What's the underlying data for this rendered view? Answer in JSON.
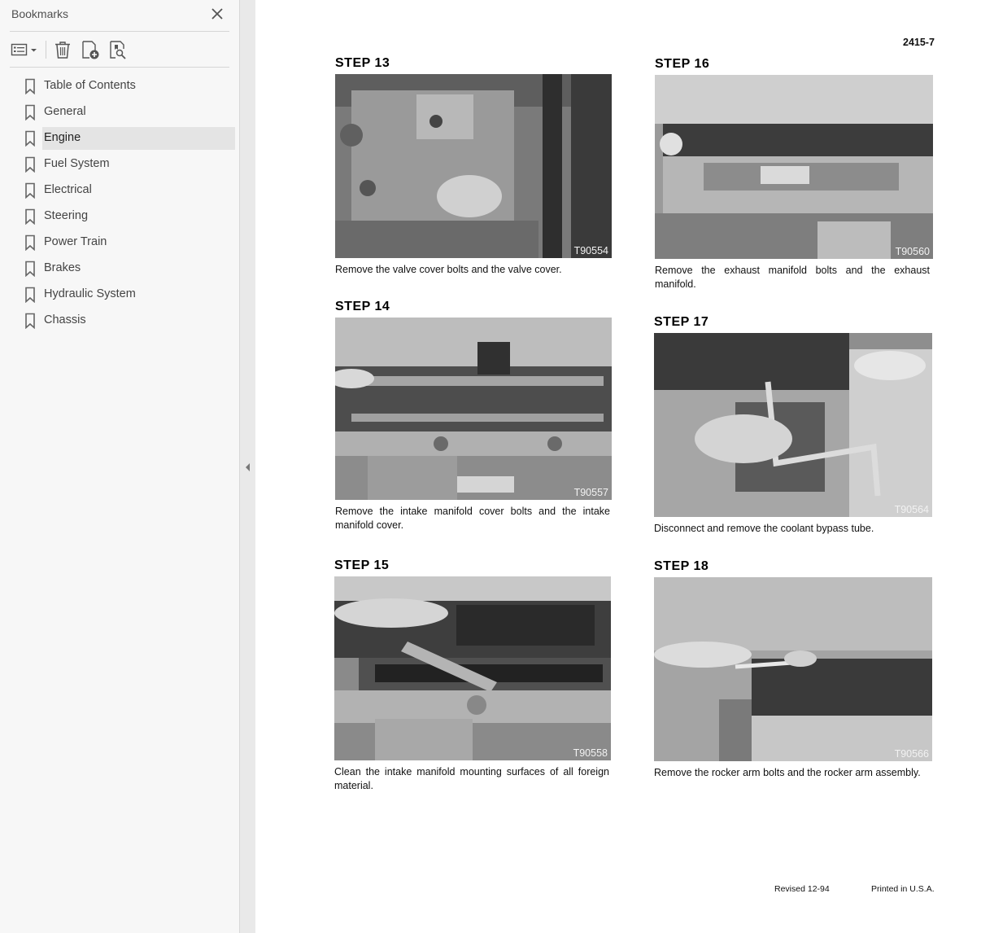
{
  "sidebar": {
    "title": "Bookmarks",
    "close_icon": "close-icon",
    "toolbar": {
      "options": "bookmark-options-icon",
      "delete": "trash-icon",
      "add": "add-bookmark-icon",
      "find": "find-bookmark-icon"
    },
    "items": [
      {
        "label": "Table of Contents",
        "selected": false
      },
      {
        "label": "General",
        "selected": false
      },
      {
        "label": "Engine",
        "selected": true
      },
      {
        "label": "Fuel System",
        "selected": false
      },
      {
        "label": "Electrical",
        "selected": false
      },
      {
        "label": "Steering",
        "selected": false
      },
      {
        "label": "Power Train",
        "selected": false
      },
      {
        "label": "Brakes",
        "selected": false
      },
      {
        "label": "Hydraulic System",
        "selected": false
      },
      {
        "label": "Chassis",
        "selected": false
      }
    ]
  },
  "page": {
    "page_number": "2415-7",
    "steps": [
      {
        "title": "STEP  13",
        "photo_code": "T90554",
        "caption": "Remove the valve cover bolts and the valve cover."
      },
      {
        "title": "STEP  14",
        "photo_code": "T90557",
        "caption": "Remove the intake manifold cover bolts and the intake manifold cover."
      },
      {
        "title": "STEP  15",
        "photo_code": "T90558",
        "caption": "Clean the intake manifold mounting surfaces of all foreign material."
      },
      {
        "title": "STEP  16",
        "photo_code": "T90560",
        "caption": "Remove the exhaust manifold bolts and the exhaust manifold."
      },
      {
        "title": "STEP  17",
        "photo_code": "T90564",
        "caption": "Disconnect and remove the coolant bypass tube."
      },
      {
        "title": "STEP  18",
        "photo_code": "T90566",
        "caption": "Remove the rocker arm bolts and the rocker arm assembly."
      }
    ],
    "footer": {
      "revised": "Revised 12-94",
      "printed": "Printed in U.S.A."
    }
  },
  "colors": {
    "sidebar_bg": "#f7f7f7",
    "selected_bg": "#e4e4e4",
    "splitter_bg": "#e9e9e9"
  }
}
